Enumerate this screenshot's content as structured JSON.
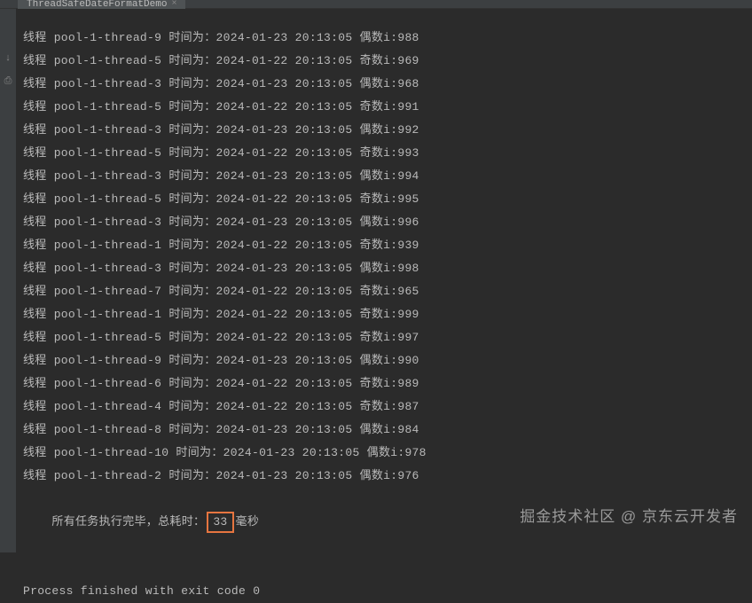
{
  "tab": {
    "title": "ThreadSafeDateFormatDemo",
    "close": "×"
  },
  "gutter_icons": {
    "i1": "↓",
    "i2": "⎙"
  },
  "logs": [
    "线程 pool-1-thread-9 时间为：2024-01-23 20:13:05 偶数i:988",
    "线程 pool-1-thread-5 时间为：2024-01-22 20:13:05 奇数i:969",
    "线程 pool-1-thread-3 时间为：2024-01-23 20:13:05 偶数i:968",
    "线程 pool-1-thread-5 时间为：2024-01-22 20:13:05 奇数i:991",
    "线程 pool-1-thread-3 时间为：2024-01-23 20:13:05 偶数i:992",
    "线程 pool-1-thread-5 时间为：2024-01-22 20:13:05 奇数i:993",
    "线程 pool-1-thread-3 时间为：2024-01-23 20:13:05 偶数i:994",
    "线程 pool-1-thread-5 时间为：2024-01-22 20:13:05 奇数i:995",
    "线程 pool-1-thread-3 时间为：2024-01-23 20:13:05 偶数i:996",
    "线程 pool-1-thread-1 时间为：2024-01-22 20:13:05 奇数i:939",
    "线程 pool-1-thread-3 时间为：2024-01-23 20:13:05 偶数i:998",
    "线程 pool-1-thread-7 时间为：2024-01-22 20:13:05 奇数i:965",
    "线程 pool-1-thread-1 时间为：2024-01-22 20:13:05 奇数i:999",
    "线程 pool-1-thread-5 时间为：2024-01-22 20:13:05 奇数i:997",
    "线程 pool-1-thread-9 时间为：2024-01-23 20:13:05 偶数i:990",
    "线程 pool-1-thread-6 时间为：2024-01-22 20:13:05 奇数i:989",
    "线程 pool-1-thread-4 时间为：2024-01-22 20:13:05 奇数i:987",
    "线程 pool-1-thread-8 时间为：2024-01-23 20:13:05 偶数i:984",
    "线程 pool-1-thread-10 时间为：2024-01-23 20:13:05 偶数i:978",
    "线程 pool-1-thread-2 时间为：2024-01-23 20:13:05 偶数i:976"
  ],
  "summary": {
    "prefix": "所有任务执行完毕，总耗时：",
    "highlight": "33",
    "suffix": "毫秒"
  },
  "finished": "Process finished with exit code 0",
  "watermark": "掘金技术社区 @ 京东云开发者"
}
